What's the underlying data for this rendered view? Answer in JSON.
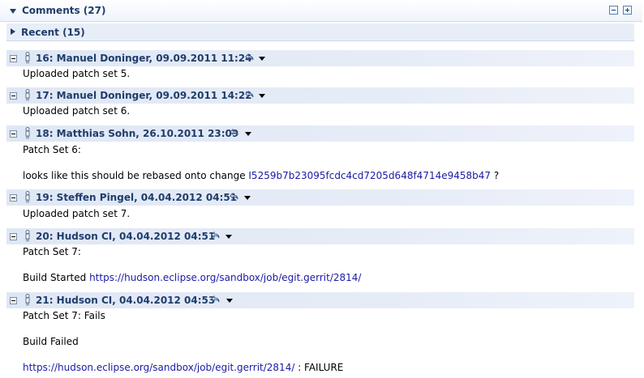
{
  "section": {
    "title": "Comments (27)",
    "collapse_all": "collapse-all",
    "expand_all": "expand-all"
  },
  "recent": {
    "title": "Recent (15)"
  },
  "comments": [
    {
      "title": "16: Manuel Doninger, 09.09.2011 11:24",
      "lines": [
        "Uploaded patch set 5."
      ]
    },
    {
      "title": "17: Manuel Doninger, 09.09.2011 14:22",
      "lines": [
        "Uploaded patch set 6."
      ]
    },
    {
      "title": "18: Matthias Sohn, 26.10.2011 23:09",
      "line1": "Patch Set 6:",
      "line2_prefix": "looks like this should be rebased onto change ",
      "line2_link": "I5259b7b23095fcdc4cd7205d648f4714e9458b47",
      "line2_suffix": " ?"
    },
    {
      "title": "19: Steffen Pingel, 04.04.2012 04:51",
      "lines": [
        "Uploaded patch set 7."
      ]
    },
    {
      "title": "20: Hudson CI, 04.04.2012 04:51",
      "line1": "Patch Set 7:",
      "line2_prefix": "Build Started ",
      "line2_link": "https://hudson.eclipse.org/sandbox/job/egit.gerrit/2814/"
    },
    {
      "title": "21: Hudson CI, 04.04.2012 04:53",
      "line1": "Patch Set 7: Fails",
      "line2": "Build Failed",
      "line3_link": "https://hudson.eclipse.org/sandbox/job/egit.gerrit/2814/",
      "line3_suffix": " : FAILURE"
    }
  ]
}
